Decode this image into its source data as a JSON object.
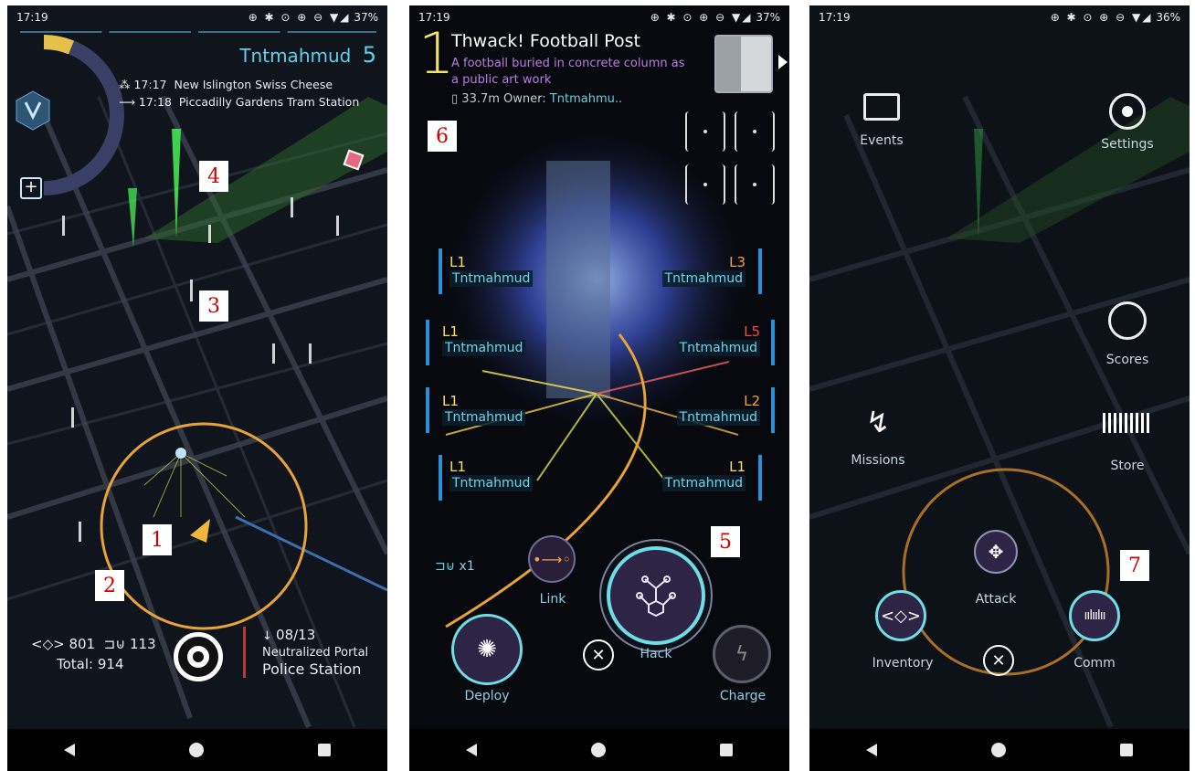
{
  "colors": {
    "accent": "#5fd2e6",
    "enlightened": "#3ec94d",
    "faction_yellow": "#f5e26a",
    "xm_ring": "#e8a23a",
    "marker_red": "#d10000"
  },
  "panel1": {
    "status": {
      "time": "17:19",
      "icons": "⊕ ✱ ⊙ ⊕ ⊖ ▼◢",
      "battery": "37%"
    },
    "agent": {
      "name": "Tntmahmud",
      "level": "5"
    },
    "schedule": [
      {
        "icon": "tram-stop-icon",
        "time": "17:17",
        "stop": "New Islington Swiss Cheese"
      },
      {
        "icon": "route-arrow-icon",
        "time": "17:18",
        "stop": "Piccadilly Gardens Tram Station"
      }
    ],
    "zoom_button": "+",
    "inventory": {
      "xm_keys_label": "801",
      "resonators_label": "113",
      "total": "Total: 914"
    },
    "portal": {
      "count": "08/13",
      "status": "Neutralized Portal",
      "name": "Police Station"
    },
    "markers": [
      "1",
      "2",
      "3",
      "4"
    ]
  },
  "panel2": {
    "status": {
      "time": "17:19",
      "icons": "⊕ ✱ ⊙ ⊕ ⊖ ▼◢",
      "battery": "37%"
    },
    "portal": {
      "level": "1",
      "title": "Thwack! Football Post",
      "description": "A football buried in concrete column as a public art work",
      "distance": "33.7m",
      "owner_label": "Owner:",
      "owner": "Tntmahmu.."
    },
    "resonators": [
      {
        "level": "L1",
        "level_color": "yellow",
        "owner": "Tntmahmud"
      },
      {
        "level": "L3",
        "level_color": "orange",
        "owner": "Tntmahmud"
      },
      {
        "level": "L1",
        "level_color": "yellow",
        "owner": "Tntmahmud"
      },
      {
        "level": "L5",
        "level_color": "red",
        "owner": "Tntmahmud"
      },
      {
        "level": "L1",
        "level_color": "yellow",
        "owner": "Tntmahmud"
      },
      {
        "level": "L2",
        "level_color": "orange",
        "owner": "Tntmahmud"
      },
      {
        "level": "L1",
        "level_color": "yellow",
        "owner": "Tntmahmud"
      },
      {
        "level": "L1",
        "level_color": "yellow",
        "owner": "Tntmahmud"
      }
    ],
    "key_count": "x1",
    "buttons": {
      "link": "Link",
      "hack": "Hack",
      "deploy": "Deploy",
      "charge": "Charge"
    },
    "markers": [
      "5",
      "6"
    ]
  },
  "panel3": {
    "status": {
      "time": "17:19",
      "icons": "⊕ ✱ ⊙ ⊕ ⊖ ▼◢",
      "battery": "36%"
    },
    "menu": {
      "events": "Events",
      "settings": "Settings",
      "scores": "Scores",
      "missions": "Missions",
      "store": "Store",
      "attack": "Attack",
      "inventory": "Inventory",
      "comm": "Comm"
    },
    "markers": [
      "7"
    ]
  }
}
